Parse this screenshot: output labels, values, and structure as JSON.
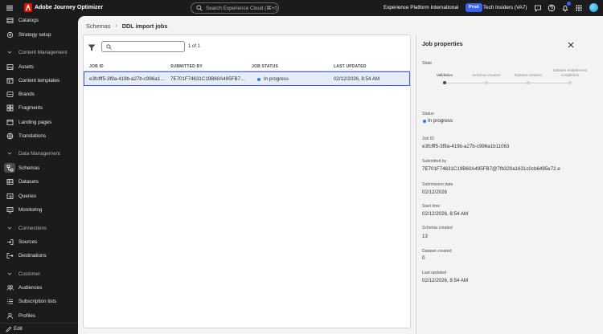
{
  "app": {
    "name": "Adobe Journey Optimizer"
  },
  "topbar": {
    "search_placeholder": "Search Experience Cloud (⌘+/)",
    "org": "Experience Platform International",
    "env_badge": "Prod",
    "sandbox": "Tech Insiders (VA7)"
  },
  "sidebar": {
    "items_top": [
      {
        "label": "Catalogs",
        "icon": "catalog-icon"
      },
      {
        "label": "Strategy setup",
        "icon": "strategy-icon"
      }
    ],
    "sections": [
      {
        "title": "Content Management",
        "items": [
          {
            "label": "Assets"
          },
          {
            "label": "Content templates"
          },
          {
            "label": "Brands"
          },
          {
            "label": "Fragments"
          },
          {
            "label": "Landing pages"
          },
          {
            "label": "Translations"
          }
        ]
      },
      {
        "title": "Data Management",
        "items": [
          {
            "label": "Schemas",
            "active": true
          },
          {
            "label": "Datasets"
          },
          {
            "label": "Queries"
          },
          {
            "label": "Monitoring"
          }
        ]
      },
      {
        "title": "Connections",
        "items": [
          {
            "label": "Sources"
          },
          {
            "label": "Destinations"
          }
        ]
      },
      {
        "title": "Customer",
        "items": [
          {
            "label": "Audiences"
          },
          {
            "label": "Subscription lists"
          },
          {
            "label": "Profiles"
          }
        ]
      }
    ],
    "edit_label": "Edit"
  },
  "breadcrumb": {
    "parent": "Schemas",
    "current": "DDL import jobs"
  },
  "list": {
    "search_placeholder": "",
    "page_count": "1 of 1",
    "columns": [
      "JOB ID",
      "SUBMITTED BY",
      "JOB STATUS",
      "LAST UPDATED"
    ],
    "rows": [
      {
        "job_id": "e3fcfff5-3f9a-419b-a27b-c996a1b1...",
        "submitted_by": "7E701F74631C19B60A495FB7@7fb...",
        "status": "In progress",
        "last_updated": "02/12/2026, 8:54 AM"
      }
    ]
  },
  "props": {
    "title": "Job properties",
    "state_label": "State",
    "steps": [
      {
        "label": "Validation",
        "active": true
      },
      {
        "label": "Schema creation",
        "active": false
      },
      {
        "label": "Dataset creation",
        "active": false
      },
      {
        "label": "Dataset enablement",
        "label2": "completion",
        "active": false
      }
    ],
    "status_label": "Status",
    "status_value": "In progress",
    "job_id_label": "Job ID",
    "job_id_value": "e3fcfff5-3f9a-419b-a27b-c996a1b11063",
    "submitted_by_label": "Submitted by",
    "submitted_by_value": "7E701F74631C19B60A495FB7@7fb320a1631c0cb6495e72.e",
    "submission_date_label": "Submission date",
    "submission_date_value": "02/12/2026",
    "start_time_label": "Start time",
    "start_time_value": "02/12/2026, 8:54 AM",
    "schema_created_label": "Schema created",
    "schema_created_value": "13",
    "dataset_created_label": "Dataset created",
    "dataset_created_value": "0",
    "last_updated_label": "Last updated",
    "last_updated_value": "02/12/2026, 8:54 AM"
  },
  "colors": {
    "accent": "#3b63fb",
    "status_blue": "#2680eb",
    "adobe_red": "#eb1000"
  }
}
